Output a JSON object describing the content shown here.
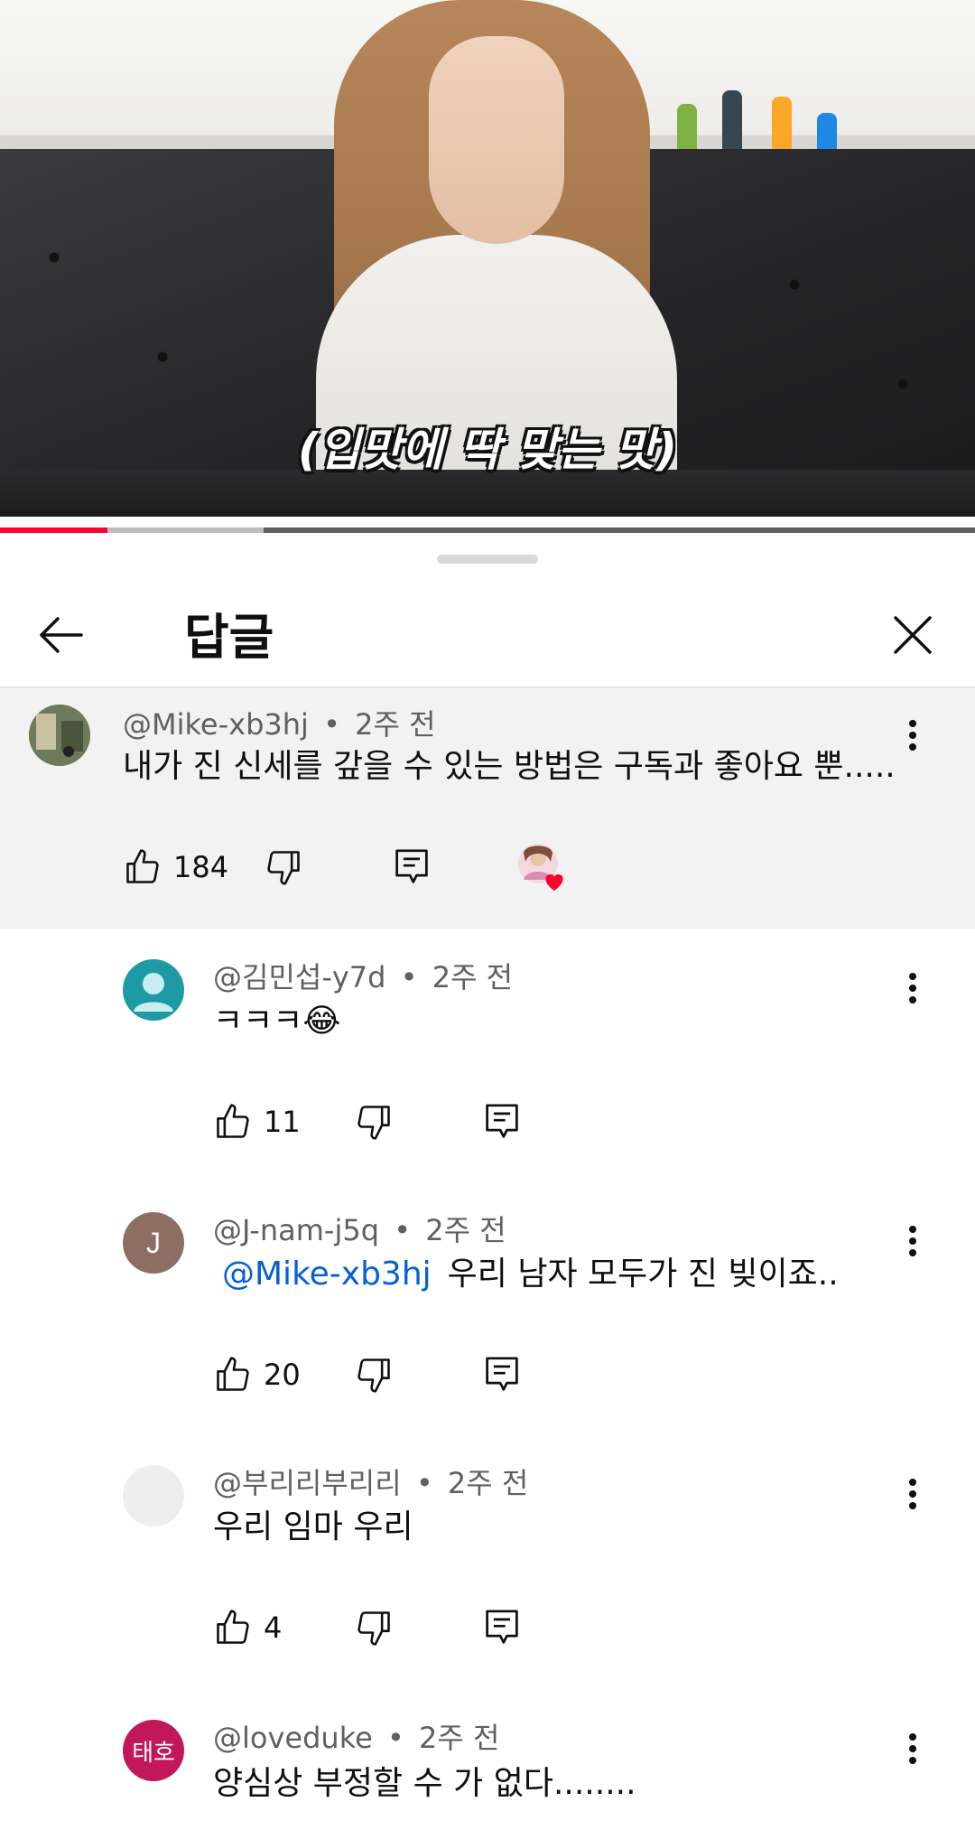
{
  "video": {
    "subtitle": "(입맛에 딱 맞는 맛)",
    "progress_played_fraction": 0.11,
    "progress_buffered_fraction": 0.27
  },
  "header": {
    "title": "답글",
    "back_icon": "arrow-left-icon",
    "close_icon": "close-icon"
  },
  "parent_comment": {
    "author": "@Mike-xb3hj",
    "time": "2주 전",
    "text": "내가 진 신세를 갚을 수 있는 방법은 구독과 좋아요 뿐.....",
    "likes": "184",
    "creator_heart": true
  },
  "replies": [
    {
      "author": "@김민섭-y7d",
      "time": "2주 전",
      "text": "ㅋㅋㅋ😂",
      "likes": "11",
      "avatar_color": "#1e9aa5"
    },
    {
      "author": "@J-nam-j5q",
      "time": "2주 전",
      "mention": "@Mike-xb3hj",
      "text": "우리 남자 모두가 진 빚이죠..",
      "likes": "20",
      "avatar_letter": "J",
      "avatar_color": "#8d6e63"
    },
    {
      "author": "@부리리부리리",
      "time": "2주 전",
      "text": "우리 임마 우리",
      "likes": "4",
      "avatar_color": "#eeeeee"
    },
    {
      "author": "@loveduke",
      "time": "2주 전",
      "text": "양심상 부정할 수 가 없다........",
      "avatar_letter": "태호",
      "avatar_color": "#c2185b"
    }
  ],
  "dot_separator": "•",
  "colors": {
    "accent_red": "#ff0033",
    "mention_blue": "#065fd4",
    "highlight_bg": "#f2f2f2"
  }
}
